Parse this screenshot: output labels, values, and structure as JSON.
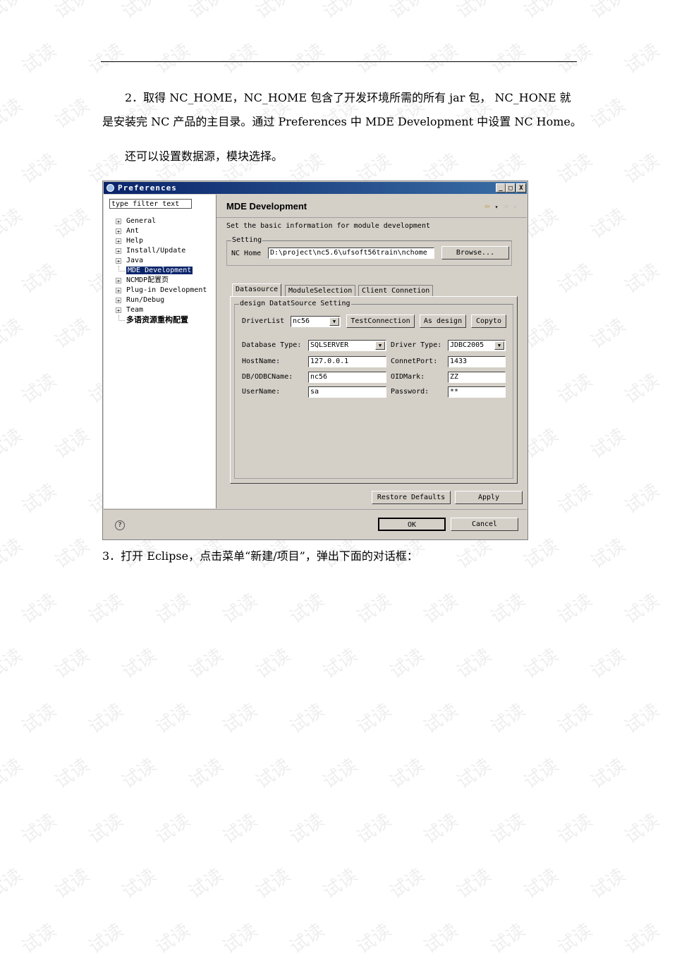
{
  "watermark": "试读",
  "doc": {
    "para1": "2．取得 NC_HOME，NC_HOME 包含了开发环境所需的所有 jar 包， NC_HONE 就是安装完 NC 产品的主目录。通过 Preferences 中 MDE Development 中设置 NC Home。",
    "para2": "还可以设置数据源，模块选择。",
    "para3": "3．打开 Eclipse，点击菜单“新建/项目”，弹出下面的对话框："
  },
  "dialog": {
    "title": "Preferences",
    "window_buttons": {
      "minimize": "_",
      "maximize": "□",
      "close": "X"
    },
    "filter_placeholder": "type filter text",
    "tree": [
      {
        "label": "General",
        "expandable": true
      },
      {
        "label": "Ant",
        "expandable": true
      },
      {
        "label": "Help",
        "expandable": true
      },
      {
        "label": "Install/Update",
        "expandable": true
      },
      {
        "label": "Java",
        "expandable": true
      },
      {
        "label": "MDE Development",
        "expandable": false,
        "selected": true
      },
      {
        "label": "NCMDP配置页",
        "expandable": true
      },
      {
        "label": "Plug-in Development",
        "expandable": true
      },
      {
        "label": "Run/Debug",
        "expandable": true
      },
      {
        "label": "Team",
        "expandable": true
      },
      {
        "label": "多语资源重构配置",
        "expandable": false
      }
    ],
    "page_title": "MDE Development",
    "description": "Set the basic information for module development",
    "setting_group": "Setting",
    "nc_home_label": "NC Home",
    "nc_home_value": "D:\\project\\nc5.6\\ufsoft56train\\nchome",
    "browse_label": "Browse...",
    "tabs": [
      "Datasource",
      "ModuleSelection",
      "Client Connetion"
    ],
    "ds_group": "design DatatSource Setting",
    "driverlist_label": "DriverList",
    "driverlist_value": "nc56",
    "test_connection": "TestConnection",
    "as_design": "As design",
    "copyto": "Copyto",
    "db_type_label": "Database Type:",
    "db_type_value": "SQLSERVER",
    "driver_type_label": "Driver Type:",
    "driver_type_value": "JDBC2005",
    "hostname_label": "HostName:",
    "hostname_value": "127.0.0.1",
    "port_label": "ConnetPort:",
    "port_value": "1433",
    "dbname_label": "DB/ODBCName:",
    "dbname_value": "nc56",
    "oidmark_label": "OIDMark:",
    "oidmark_value": "ZZ",
    "username_label": "UserName:",
    "username_value": "sa",
    "password_label": "Password:",
    "password_value": "**",
    "restore_defaults": "Restore Defaults",
    "apply": "Apply",
    "ok": "OK",
    "cancel": "Cancel",
    "help_glyph": "?"
  }
}
